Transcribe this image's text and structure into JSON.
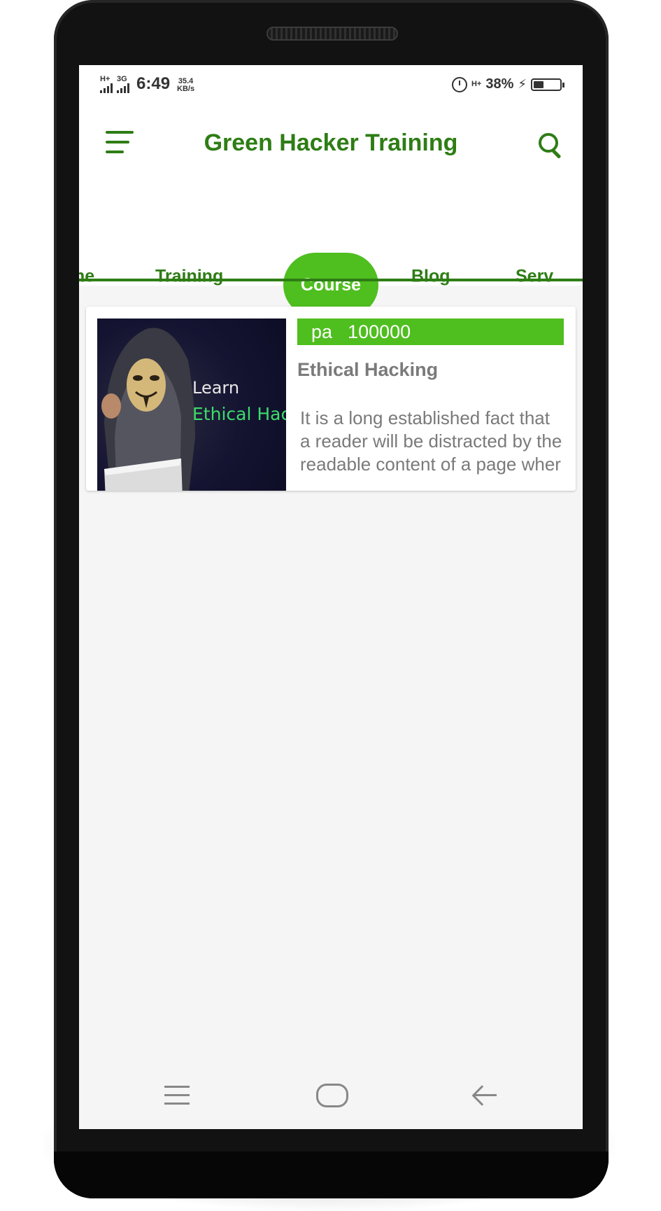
{
  "status_bar": {
    "net1": "H+",
    "net2": "3G",
    "time": "6:49",
    "speed_value": "35.4",
    "speed_unit": "KB/s",
    "net3": "H+",
    "battery_percent": "38%",
    "battery_level": 0.38
  },
  "app_bar": {
    "title": "Green Hacker Training",
    "menu_icon": "menu-icon",
    "search_icon": "search-icon"
  },
  "tabs": [
    {
      "label": "me"
    },
    {
      "label": "Training"
    },
    {
      "label": "Course",
      "active": true
    },
    {
      "label": "Blog"
    },
    {
      "label": "Serv"
    }
  ],
  "course": {
    "price_label": "pa",
    "price_value": "100000",
    "title": "Ethical Hacking",
    "description_lines": [
      "It is a long established fact that",
      "a reader will be distracted by the",
      "readable content of a page wher"
    ],
    "image": {
      "line1": "Learn",
      "line2": "Ethical Hackir"
    }
  },
  "nav_bar": {
    "recents_icon": "recents-icon",
    "home_icon": "home-icon",
    "back_icon": "back-icon"
  },
  "colors": {
    "primary": "#2e7d15",
    "accent": "#4fbe1f",
    "muted_text": "#7a7a7a"
  }
}
